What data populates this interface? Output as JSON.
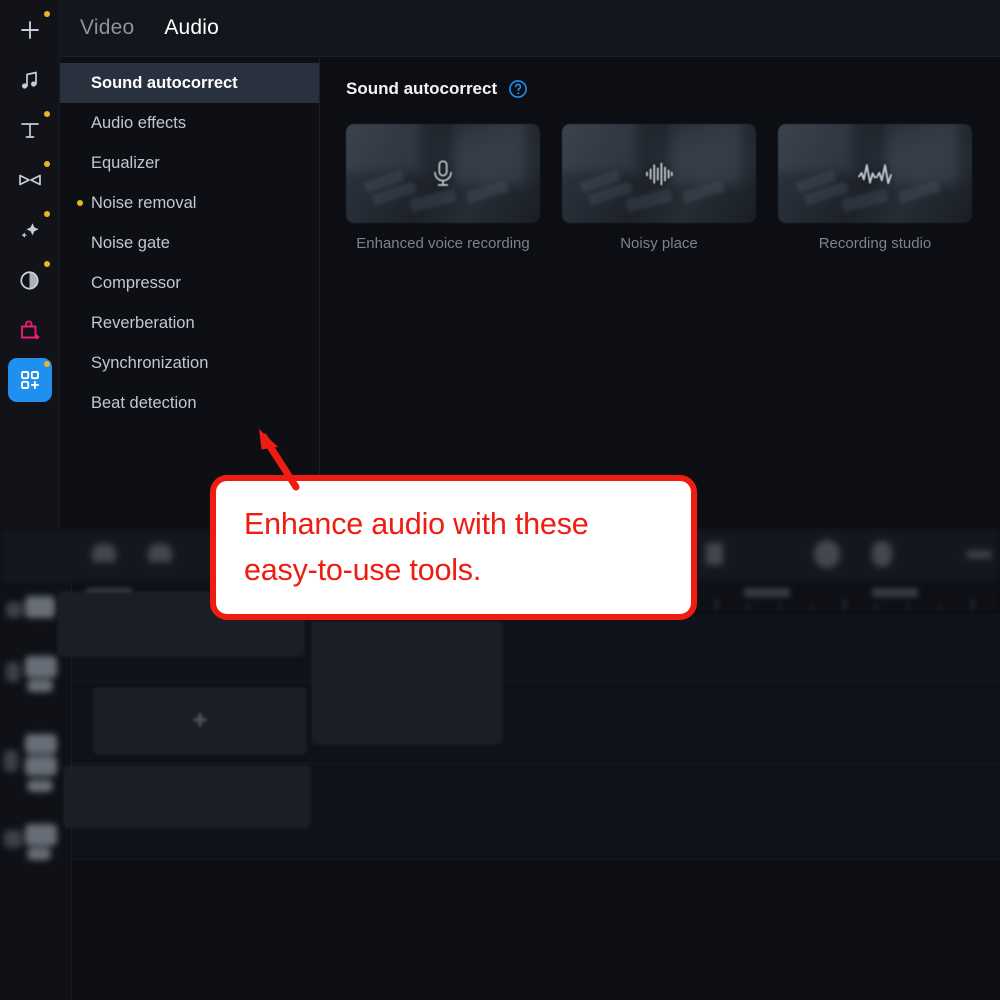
{
  "rail": {
    "items": [
      {
        "name": "add-media-icon",
        "icon": "plus",
        "badge": true,
        "style": "normal"
      },
      {
        "name": "audio-icon",
        "icon": "music-note",
        "badge": false,
        "style": "normal"
      },
      {
        "name": "titles-icon",
        "icon": "text-t",
        "badge": true,
        "style": "normal"
      },
      {
        "name": "transitions-icon",
        "icon": "transition-bowtie",
        "badge": true,
        "style": "normal"
      },
      {
        "name": "filters-icon",
        "icon": "sparkle-diamond",
        "badge": true,
        "style": "normal"
      },
      {
        "name": "color-adjust-icon",
        "icon": "circle-pie",
        "badge": true,
        "style": "normal"
      },
      {
        "name": "store-icon",
        "icon": "shopping-bag-plus",
        "badge": false,
        "style": "pink"
      },
      {
        "name": "more-tools-icon",
        "icon": "grid-plus",
        "badge": true,
        "style": "active-blue"
      }
    ]
  },
  "tabs": [
    {
      "label": "Video",
      "active": false
    },
    {
      "label": "Audio",
      "active": true
    }
  ],
  "categories": [
    {
      "label": "Sound autocorrect",
      "selected": true,
      "badge": false
    },
    {
      "label": "Audio effects",
      "selected": false,
      "badge": false
    },
    {
      "label": "Equalizer",
      "selected": false,
      "badge": false
    },
    {
      "label": "Noise removal",
      "selected": false,
      "badge": true
    },
    {
      "label": "Noise gate",
      "selected": false,
      "badge": false
    },
    {
      "label": "Compressor",
      "selected": false,
      "badge": false
    },
    {
      "label": "Reverberation",
      "selected": false,
      "badge": false
    },
    {
      "label": "Synchronization",
      "selected": false,
      "badge": false
    },
    {
      "label": "Beat detection",
      "selected": false,
      "badge": false
    }
  ],
  "content": {
    "title": "Sound autocorrect",
    "help_icon": "question-circle-icon",
    "presets": [
      {
        "label": "Enhanced voice recording",
        "icon": "microphone-icon"
      },
      {
        "label": "Noisy place",
        "icon": "equalizer-bars-icon"
      },
      {
        "label": "Recording studio",
        "icon": "waveform-icon"
      }
    ]
  },
  "callout": {
    "text": "Enhance audio with these easy-to-use tools.",
    "border_color": "#f01c11",
    "text_color": "#f01c11",
    "background_color": "#ffffff"
  },
  "colors": {
    "accent_blue": "#1f8ff0",
    "badge_yellow": "#e8b52a",
    "store_pink": "#ef1a7a",
    "panel_bg": "#0c0e14",
    "selected_row": "#2a313e"
  }
}
